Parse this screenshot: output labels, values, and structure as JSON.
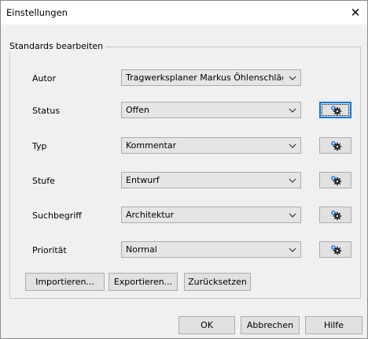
{
  "window": {
    "title": "Einstellungen",
    "close_glyph": "✕"
  },
  "group": {
    "title": "Standards bearbeiten"
  },
  "rows": [
    {
      "label": "Autor",
      "value": "Tragwerksplaner Markus Öhlenschläger (m"
    },
    {
      "label": "Status",
      "value": "Offen"
    },
    {
      "label": "Typ",
      "value": "Kommentar"
    },
    {
      "label": "Stufe",
      "value": "Entwurf"
    },
    {
      "label": "Suchbegriff",
      "value": "Architektur"
    },
    {
      "label": "Priorität",
      "value": "Normal"
    }
  ],
  "actions": {
    "import": "Importieren...",
    "export": "Exportieren...",
    "reset": "Zurücksetzen"
  },
  "footer": {
    "ok": "OK",
    "cancel": "Abbrechen",
    "help": "Hilfe"
  },
  "icons": {
    "gear": "settings-gear-icon",
    "dropdown": "chevron-down-icon"
  },
  "colors": {
    "accent": "#0078d7",
    "gear_blue": "#3a8ee6",
    "gear_dark": "#222222"
  }
}
